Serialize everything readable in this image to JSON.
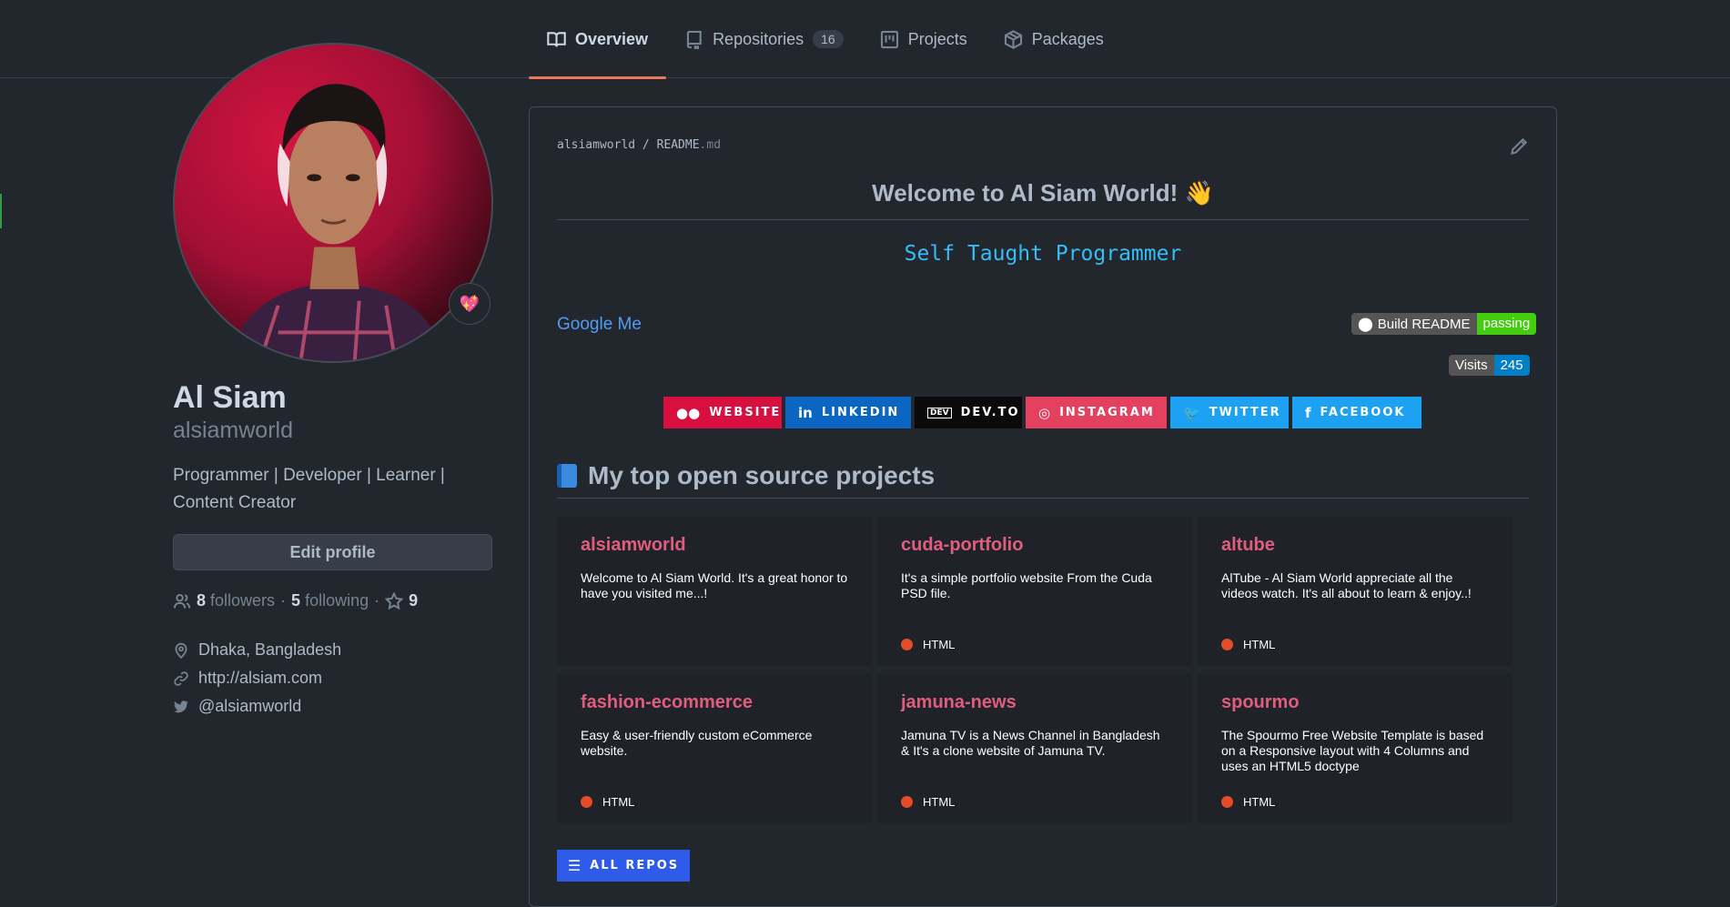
{
  "nav": {
    "tabs": [
      {
        "label": "Overview",
        "icon": "book-icon"
      },
      {
        "label": "Repositories",
        "icon": "repo-icon",
        "count": "16"
      },
      {
        "label": "Projects",
        "icon": "project-icon"
      },
      {
        "label": "Packages",
        "icon": "package-icon"
      }
    ]
  },
  "profile": {
    "status_emoji": "💖",
    "name": "Al Siam",
    "login": "alsiamworld",
    "bio": "Programmer | Developer | Learner | Content Creator",
    "edit_label": "Edit profile",
    "followers_count": "8",
    "followers_label": "followers",
    "following_count": "5",
    "following_label": "following",
    "separator": "·",
    "stars": "9",
    "location": "Dhaka, Bangladesh",
    "website": "http://alsiam.com",
    "twitter": "@alsiamworld"
  },
  "readme": {
    "path_owner": "alsiamworld",
    "path_sep": "/",
    "path_file": "README",
    "path_ext": ".md",
    "welcome": "Welcome to Al Siam World! 👋",
    "typing": "Self Taught Programmer",
    "google_link": "Google Me",
    "build_badge": {
      "label": "Build README",
      "status": "passing",
      "label_color": "#555555",
      "status_color": "#44cc11"
    },
    "visits_badge": {
      "label": "Visits",
      "count": "245",
      "count_color": "#007ec6"
    },
    "socials": [
      {
        "label": "WEBSITE",
        "icon": "●●",
        "color": "#d7103f"
      },
      {
        "label": "LINKEDIN",
        "icon": "in",
        "color": "#0a66c2"
      },
      {
        "label": "DEV.TO",
        "icon": "DEV",
        "color": "#0a0a0a"
      },
      {
        "label": "INSTAGRAM",
        "icon": "◎",
        "color": "#e4405f"
      },
      {
        "label": "TWITTER",
        "icon": "🐦",
        "color": "#1da1f2"
      },
      {
        "label": "FACEBOOK",
        "icon": "f",
        "color": "#1da1f2"
      }
    ],
    "projects_heading": "My top open source projects",
    "projects": [
      {
        "title": "alsiamworld",
        "desc": "Welcome to Al Siam World. It's a great honor to have you visited me...!",
        "lang": ""
      },
      {
        "title": "cuda-portfolio",
        "desc": "It's a simple portfolio website From the Cuda PSD file.",
        "lang": "HTML"
      },
      {
        "title": "altube",
        "desc": "AlTube - Al Siam World appreciate all the videos watch. It's all about to learn & enjoy..!",
        "lang": "HTML"
      },
      {
        "title": "fashion-ecommerce",
        "desc": "Easy & user-friendly custom eCommerce website.",
        "lang": "HTML"
      },
      {
        "title": "jamuna-news",
        "desc": "Jamuna TV is a News Channel in Bangladesh & It's a clone website of Jamuna TV.",
        "lang": "HTML"
      },
      {
        "title": "spourmo",
        "desc": "The Spourmo Free Website Template is based on a Responsive layout with 4 Columns and uses an HTML5 doctype",
        "lang": "HTML"
      }
    ],
    "all_repos": "ALL REPOS",
    "colors": {
      "card_title": "#e05d7e",
      "html_dot": "#e34c26",
      "typing": "#36bcf7",
      "accent": "#ec775c"
    }
  }
}
